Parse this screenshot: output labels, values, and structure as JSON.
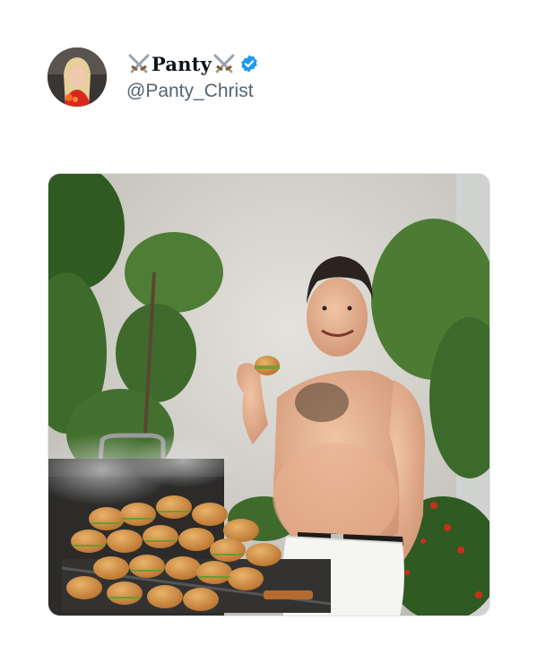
{
  "user": {
    "display_name": "Panty",
    "handle": "@Panty_Christ",
    "verified": true,
    "badge_color": "#1d9bf0",
    "icons": [
      "crossed-swords-icon",
      "verified-badge-icon"
    ]
  },
  "media": {
    "type": "photo"
  }
}
